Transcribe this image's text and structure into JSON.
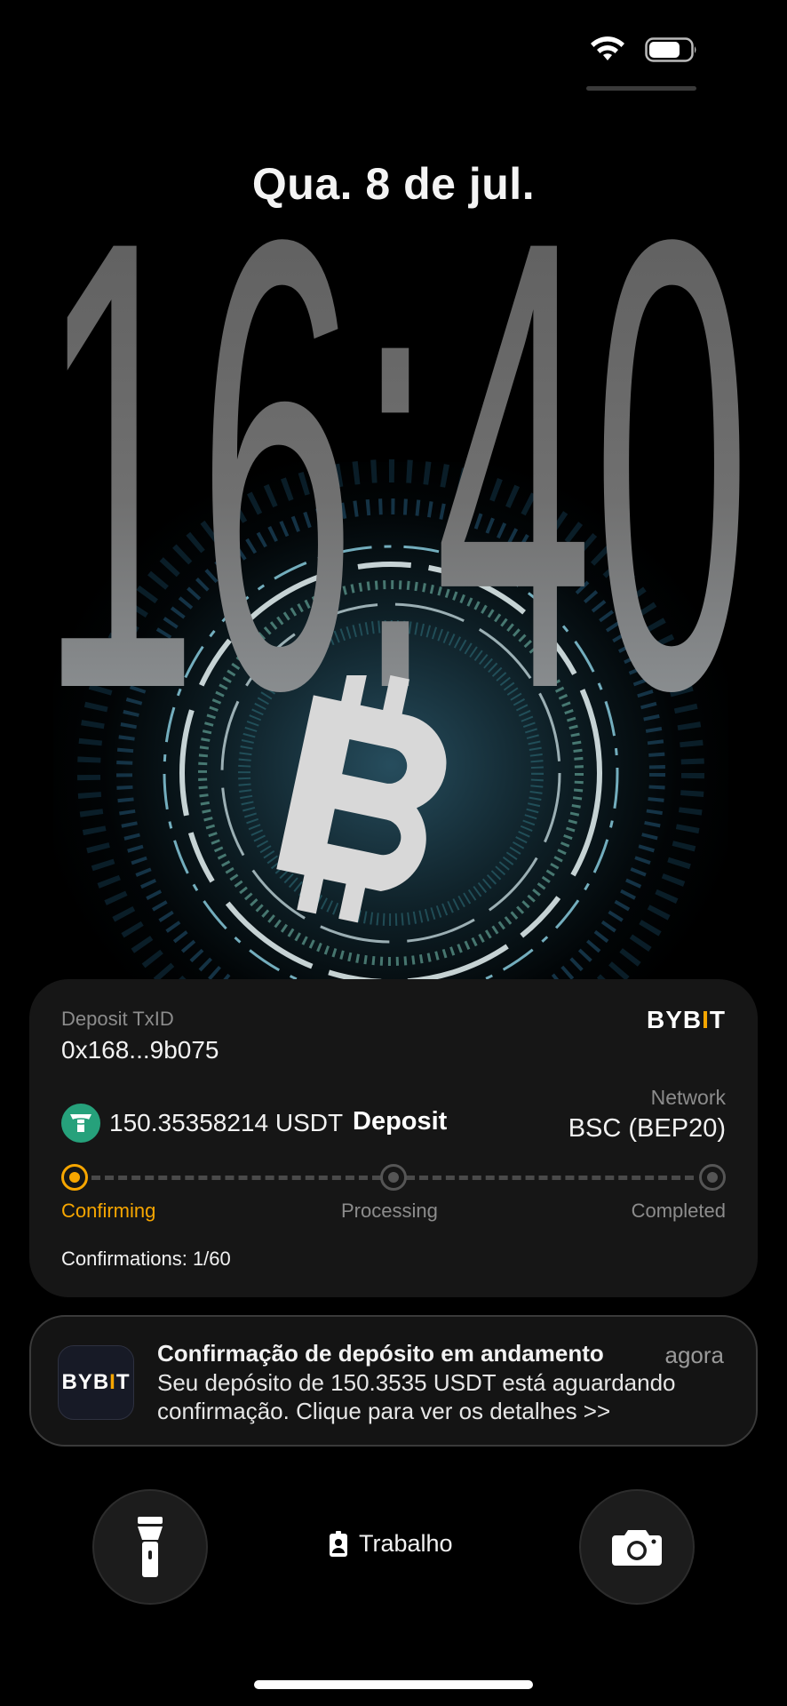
{
  "lock_screen": {
    "date": "Qua. 8 de jul.",
    "time": "16:40"
  },
  "status_bar": {
    "wifi_icon": "wifi-icon",
    "battery_icon": "battery-icon"
  },
  "deposit_card": {
    "txid_label": "Deposit TxID",
    "txid": "0x168...9b075",
    "brand": "BYBIT",
    "token_icon": "usdt-icon",
    "amount": "150.35358214 USDT",
    "amount_type": "Deposit",
    "network_label": "Network",
    "network": "BSC (BEP20)",
    "steps": [
      {
        "label": "Confirming",
        "active": true
      },
      {
        "label": "Processing",
        "active": false
      },
      {
        "label": "Completed",
        "active": false
      }
    ],
    "confirmations": "Confirmations:  1/60"
  },
  "notification": {
    "app_icon": "BYBIT",
    "title": "Confirmação de depósito em andamento",
    "time": "agora",
    "body": "Seu depósito de 150.3535 USDT está aguardando confirmação. Clique para ver os detalhes >>"
  },
  "bottom_bar": {
    "left_button": "flashlight-icon",
    "focus_icon": "id-badge-icon",
    "focus_label": "Trabalho",
    "right_button": "camera-icon"
  },
  "colors": {
    "accent": "#f7a600",
    "usdt": "#26a17b",
    "card_bg": "#161616"
  }
}
